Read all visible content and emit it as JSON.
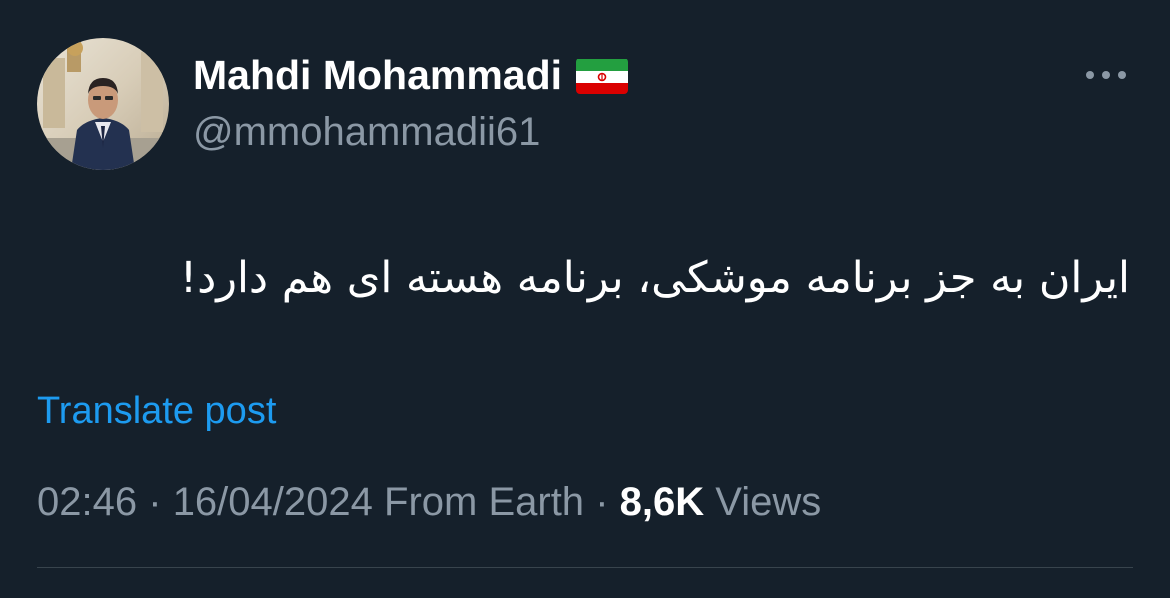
{
  "author": {
    "display_name": "Mahdi Mohammadi",
    "handle": "@mmohammadii61",
    "flag_icon": "iran-flag-icon"
  },
  "tweet": {
    "text": "ایران به جز برنامه موشکی، برنامه هسته ای هم دارد!"
  },
  "actions": {
    "translate_label": "Translate post",
    "more_icon": "more-options-icon"
  },
  "meta": {
    "time": "02:46",
    "date": "16/04/2024",
    "source": "From Earth",
    "separator": "·",
    "views_count": "8,6K",
    "views_label": "Views"
  },
  "colors": {
    "background": "#15202b",
    "text_primary": "#ffffff",
    "text_secondary": "#8b98a5",
    "link": "#1d9bf0",
    "divider": "#38444d"
  }
}
